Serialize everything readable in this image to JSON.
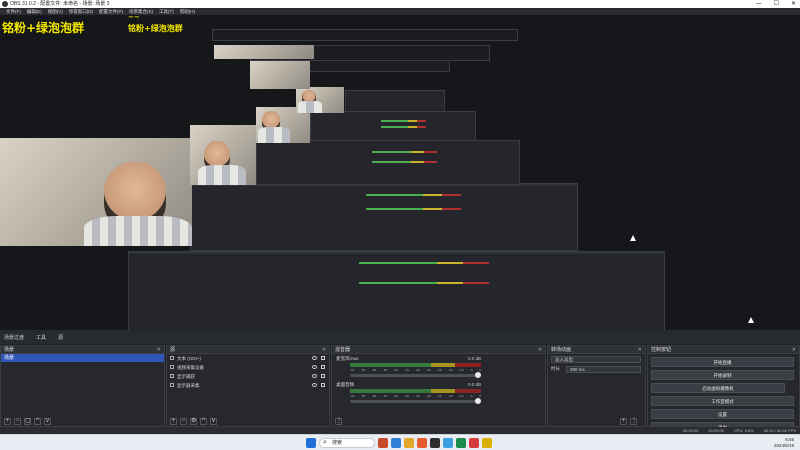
{
  "window": {
    "title": "OBS 31.0.2 - 配置文件: 未命名 - 场景: 场景 3",
    "controls": [
      "—",
      "☐",
      "✕"
    ]
  },
  "menubar": {
    "items": [
      "文件(F)",
      "编辑(E)",
      "视图(V)",
      "停靠窗口(D)",
      "配置文件(P)",
      "场景集合(S)",
      "工具(T)",
      "帮助(H)"
    ]
  },
  "preview": {
    "overlay_top": "~~",
    "overlay_text": "铭粉+绿泡泡群"
  },
  "dock_tabs": {
    "items": [
      "场景过渡",
      "工具",
      "源"
    ]
  },
  "scenes": {
    "title": "场景",
    "items": [
      "场景"
    ]
  },
  "sources": {
    "title": "源",
    "items": [
      {
        "label": "文本 (GDI+)"
      },
      {
        "label": "视频采集设备"
      },
      {
        "label": "显示捕获"
      },
      {
        "label": "显示器采集"
      }
    ]
  },
  "mixer": {
    "title": "混音器",
    "channels": [
      {
        "name": "麦克风/Aux",
        "db": "0.0 dB"
      },
      {
        "name": "桌面音频",
        "db": "0.0 dB"
      }
    ],
    "ticks": [
      "-60",
      "-55",
      "-50",
      "-45",
      "-40",
      "-35",
      "-30",
      "-25",
      "-20",
      "-15",
      "-10",
      "-5",
      "0"
    ]
  },
  "transitions": {
    "title": "转场动画",
    "type_value": "淡入淡出",
    "duration_label": "时长",
    "duration_value": "300 ms"
  },
  "controls": {
    "title": "控制按钮",
    "buttons": [
      "开始直播",
      "开始录制",
      "启动虚拟摄像机",
      "工作室模式",
      "设置",
      "退出"
    ]
  },
  "statusbar": {
    "rec_time": "00:00:00",
    "stream_time": "00:00:00",
    "cpu": "CPU: 0.6%",
    "fps": "60.00 / 60.00 FPS"
  },
  "taskbar": {
    "search_placeholder": "搜索",
    "time": "8:45",
    "date": "2024/6/19"
  },
  "colors": {
    "accent": "#2f57b8",
    "overlay": "#f4ea00",
    "meter_green": "#357a38",
    "meter_yellow": "#a69420",
    "meter_red": "#8c2121"
  }
}
